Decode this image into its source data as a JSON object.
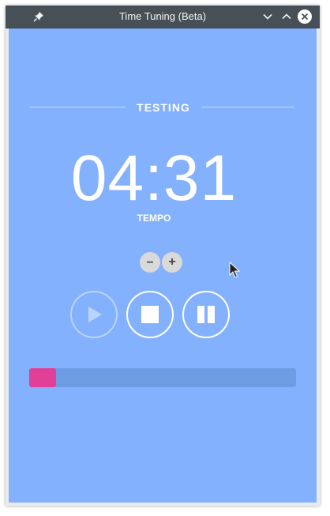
{
  "window": {
    "title": "Time Tuning (Beta)"
  },
  "titlebar_icons": {
    "pin": "pin-icon",
    "minimize": "chevron-down-icon",
    "maximize": "chevron-up-icon",
    "close": "close-icon"
  },
  "timer": {
    "section_label": "TESTING",
    "time": "04:31",
    "sublabel": "TEMPO"
  },
  "adjust": {
    "minus_label": "–",
    "plus_label": "+"
  },
  "controls": {
    "play": {
      "icon": "play-icon",
      "enabled": false
    },
    "stop": {
      "icon": "stop-icon",
      "enabled": true
    },
    "pause": {
      "icon": "pause-icon",
      "enabled": true
    }
  },
  "progress": {
    "fraction": 0.1
  },
  "colors": {
    "background": "#84b1fd",
    "progress_track": "#6e9ce2",
    "progress_fill": "#e23f99",
    "titlebar": "#475057"
  }
}
